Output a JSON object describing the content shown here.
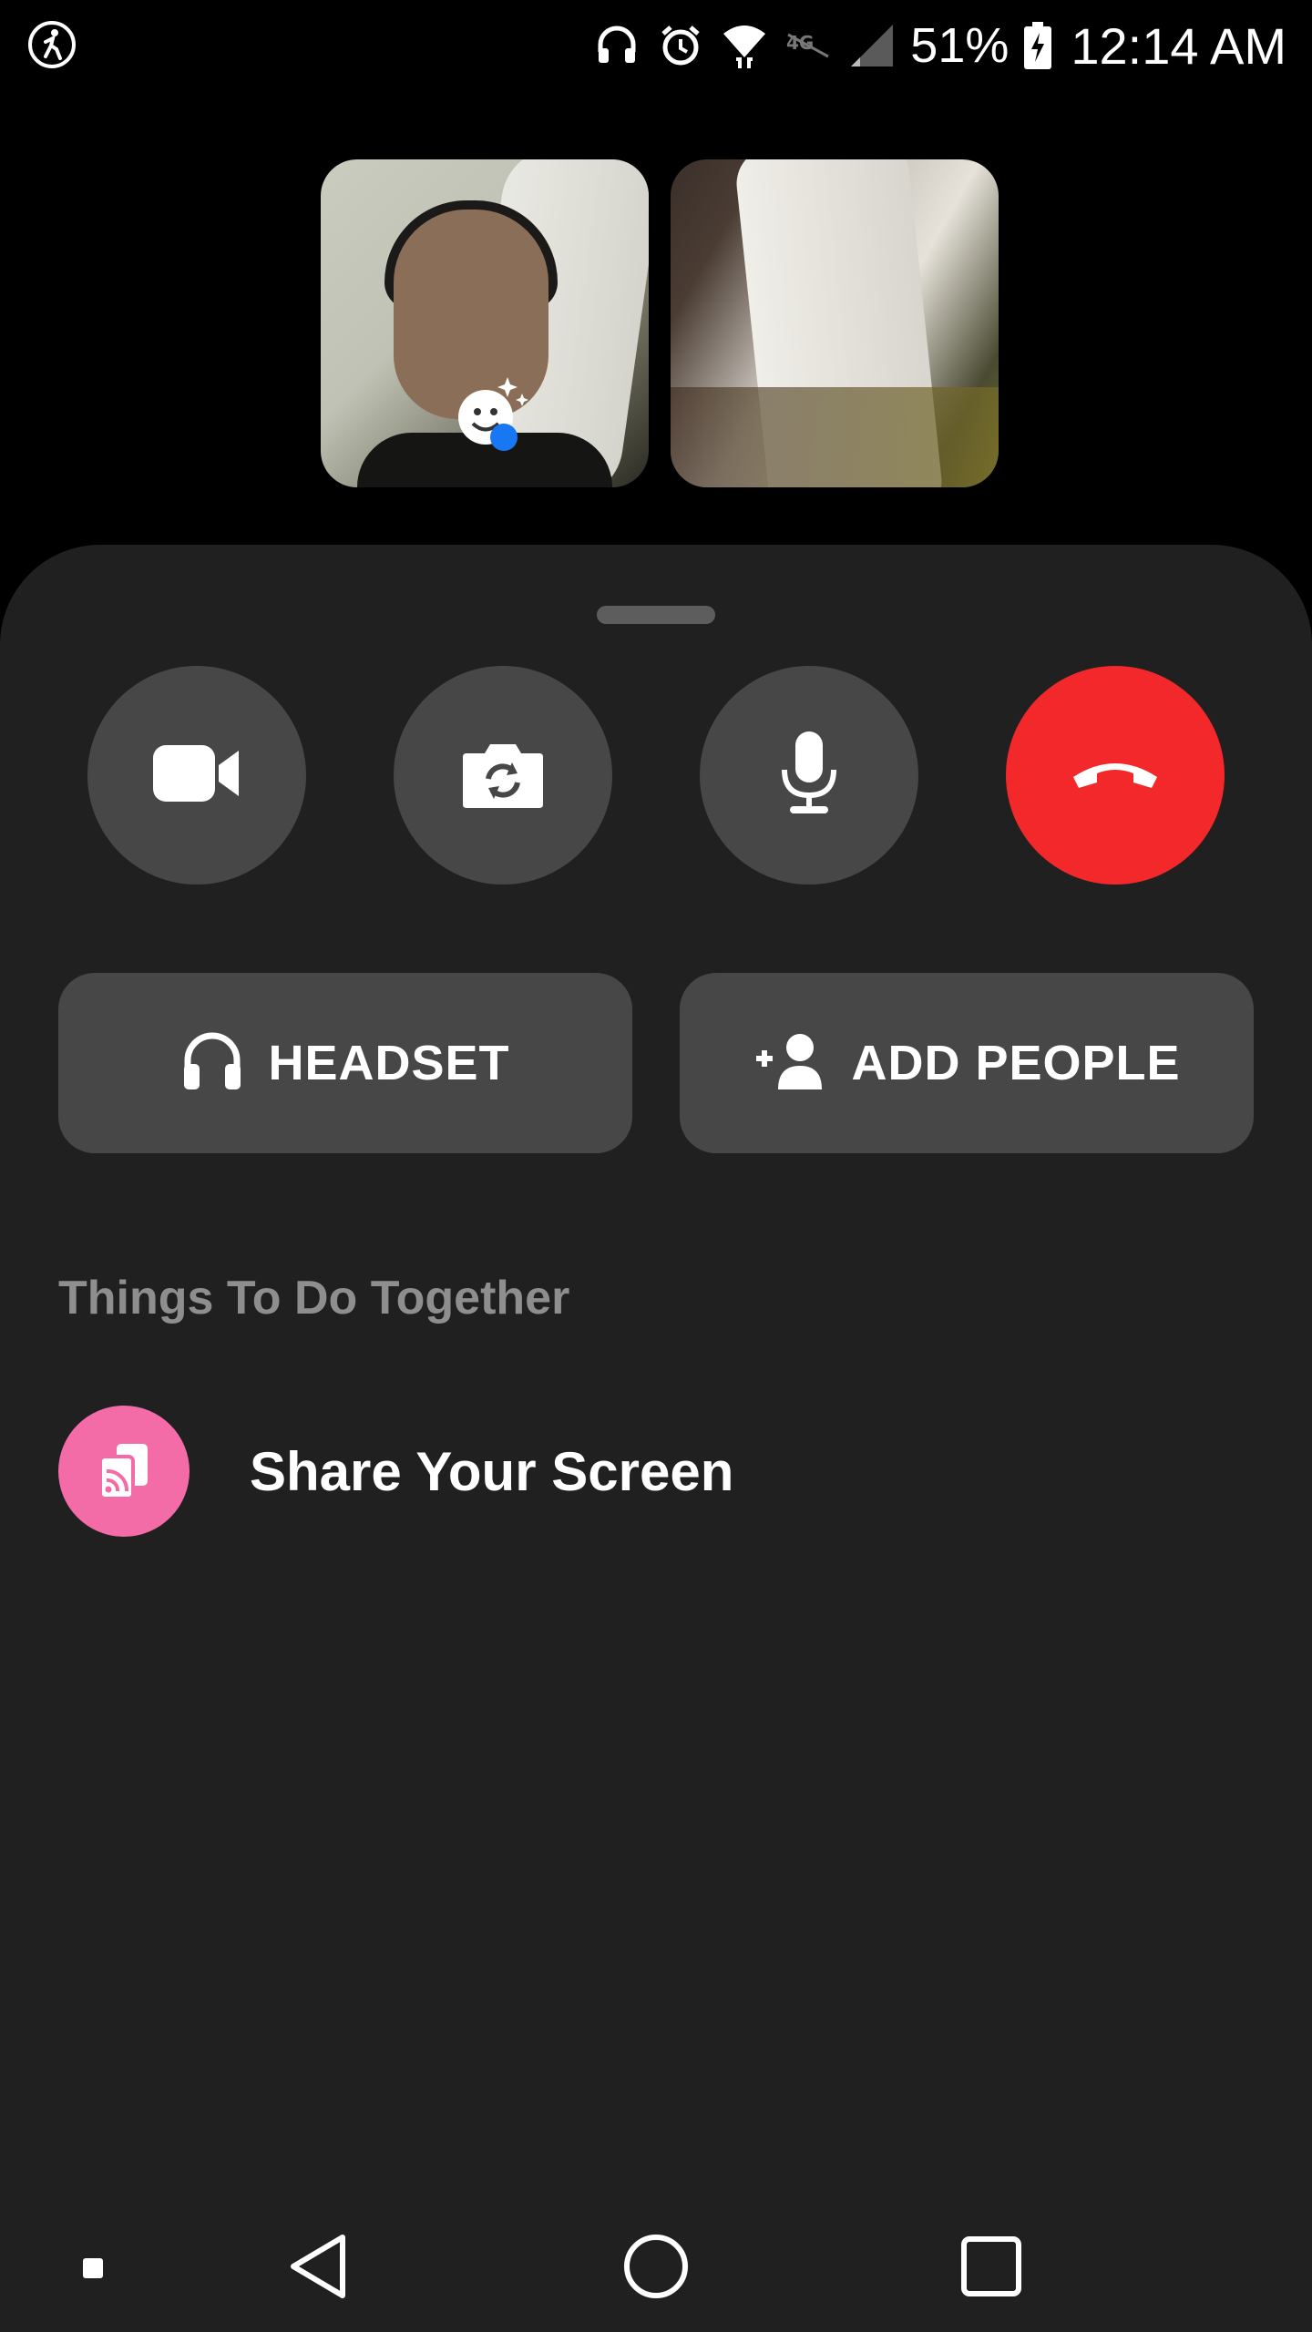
{
  "status_bar": {
    "battery_percent": "51%",
    "time": "12:14 AM",
    "icons": [
      "activity-icon",
      "headset-icon",
      "alarm-icon",
      "wifi-icon",
      "lte-icon",
      "signal-icon",
      "battery-charging-icon"
    ]
  },
  "call": {
    "tiles": [
      "self-video",
      "remote-video"
    ],
    "effects_button": "effects-icon"
  },
  "controls": {
    "buttons": [
      "video-icon",
      "camera-switch-icon",
      "microphone-icon",
      "end-call-icon"
    ],
    "end_call_color": "#f3282b"
  },
  "actions": {
    "headset_label": "HEADSET",
    "add_people_label": "ADD PEOPLE"
  },
  "together": {
    "section_title": "Things To Do Together",
    "items": [
      {
        "label": "Share Your Screen",
        "icon": "share-screen-icon",
        "color": "#f36ba7"
      }
    ]
  },
  "nav": [
    "recent-dot-icon",
    "back-icon",
    "home-icon",
    "overview-icon"
  ]
}
